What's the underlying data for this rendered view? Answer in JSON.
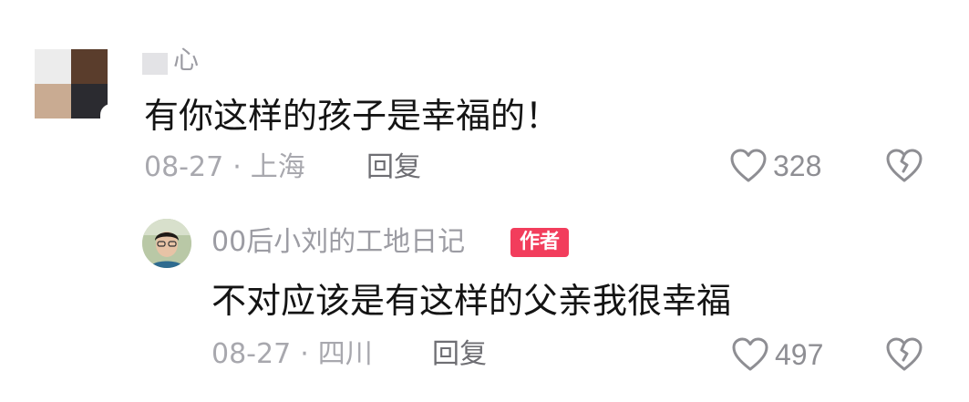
{
  "comments": [
    {
      "username": "心",
      "text": "有你这样的孩子是幸福的！",
      "date": "08-27",
      "separator": "·",
      "location": "上海",
      "reply_label": "回复",
      "like_count": "328",
      "icons": {
        "like": "heart-outline-icon",
        "dislike": "broken-heart-icon"
      }
    }
  ],
  "reply": {
    "username": "00后小刘的工地日记",
    "badge": "作者",
    "text": "不对应该是有这样的父亲我很幸福",
    "date": "08-27",
    "separator": "·",
    "location": "四川",
    "reply_label": "回复",
    "like_count": "497",
    "colors": {
      "badge_bg": "#f23d5c",
      "badge_text": "#ffffff"
    }
  },
  "colors": {
    "primary_text": "#141414",
    "meta_text": "#a8a8ae",
    "username_text": "#9c9ca3"
  }
}
